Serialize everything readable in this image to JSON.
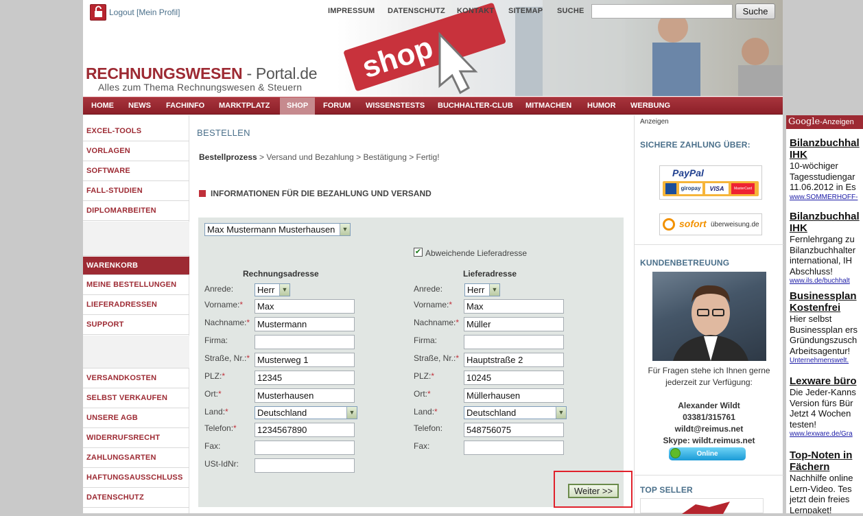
{
  "header": {
    "logout": "Logout",
    "profile": "[Mein Profil]",
    "topnav": [
      "IMPRESSUM",
      "DATENSCHUTZ",
      "KONTAKT",
      "SITEMAP",
      "SUCHE"
    ],
    "search_button": "Suche",
    "logo_main": "RECHNUNGSWESEN",
    "logo_suffix": " - Portal.de",
    "logo_tagline": "Alles zum Thema Rechnungswesen & Steuern",
    "banner_word": "shop"
  },
  "mainnav": [
    "HOME",
    "NEWS",
    "FACHINFO",
    "MARKTPLATZ",
    "SHOP",
    "FORUM",
    "WISSENSTESTS",
    "BUCHHALTER-CLUB",
    "MITMACHEN",
    "HUMOR",
    "WERBUNG"
  ],
  "mainnav_active": "SHOP",
  "sidebar": {
    "group1": [
      "EXCEL-TOOLS",
      "VORLAGEN",
      "SOFTWARE",
      "FALL-STUDIEN",
      "DIPLOMARBEITEN"
    ],
    "cart_header": "WARENKORB",
    "group2": [
      "MEINE BESTELLUNGEN",
      "LIEFERADRESSEN",
      "SUPPORT"
    ],
    "group3": [
      "VERSANDKOSTEN",
      "SELBST VERKAUFEN",
      "UNSERE AGB",
      "WIDERRUFSRECHT",
      "ZAHLUNGSARTEN",
      "HAFTUNGSAUSSCHLUSS",
      "DATENSCHUTZ"
    ]
  },
  "content": {
    "title": "BESTELLEN",
    "crumbs": {
      "current": "Bestellprozess",
      "rest": " > Versand und Bezahlung > Bestätigung > Fertig!"
    },
    "section": "INFORMATIONEN FÜR DIE BEZAHLUNG UND VERSAND",
    "address_select": "Max Mustermann Musterhausen",
    "alt_delivery_label": "Abweichende Lieferadresse",
    "alt_delivery_checked": true,
    "billing": {
      "heading": "Rechnungsadresse",
      "labels": {
        "anrede": "Anrede:",
        "vorname": "Vorname:",
        "nachname": "Nachname:",
        "firma": "Firma:",
        "strasse": "Straße, Nr.:",
        "plz": "PLZ:",
        "ort": "Ort:",
        "land": "Land:",
        "telefon": "Telefon:",
        "fax": "Fax:",
        "ustid": "USt-IdNr:"
      },
      "values": {
        "anrede": "Herr",
        "vorname": "Max",
        "nachname": "Mustermann",
        "firma": "",
        "strasse": "Musterweg 1",
        "plz": "12345",
        "ort": "Musterhausen",
        "land": "Deutschland",
        "telefon": "1234567890",
        "fax": "",
        "ustid": ""
      }
    },
    "delivery": {
      "heading": "Lieferadresse",
      "labels": {
        "anrede": "Anrede:",
        "vorname": "Vorname:",
        "nachname": "Nachname:",
        "firma": "Firma:",
        "strasse": "Straße, Nr.:",
        "plz": "PLZ:",
        "ort": "Ort:",
        "land": "Land:",
        "telefon": "Telefon:",
        "fax": "Fax:"
      },
      "values": {
        "anrede": "Herr",
        "vorname": "Max",
        "nachname": "Müller",
        "firma": "",
        "strasse": "Hauptstraße 2",
        "plz": "10245",
        "ort": "Müllerhausen",
        "land": "Deutschland",
        "telefon": "548756075",
        "fax": ""
      }
    },
    "required_mark": "*",
    "next_button": "Weiter >>"
  },
  "right": {
    "anzeigen": "Anzeigen",
    "payment_heading": "SICHERE ZAHLUNG ÜBER:",
    "paypal": "PayPal",
    "paypal_cards": [
      "giropay",
      "VISA",
      "MasterCard"
    ],
    "sofort": "sofort",
    "sofort_suffix": "überweisung.de",
    "support_heading": "KUNDENBETREUUNG",
    "support_text1": "Für Fragen stehe ich Ihnen gerne",
    "support_text2": "jederzeit zur Verfügung:",
    "contact_name": "Alexander Wildt",
    "contact_phone": "03381/315761",
    "contact_email": "wildt@reimus.net",
    "contact_skype": "Skype: wildt.reimus.net",
    "online": "Online",
    "topseller": "TOP SELLER"
  },
  "google_ads": {
    "brand": "Google",
    "label": "-Anzeigen",
    "ads": [
      {
        "title": "Bilanzbuchhal\nIHK",
        "desc": "10-wöchiger\nTagesstudiengar\n11.06.2012 in Es",
        "url": "www.SOMMERHOFF-"
      },
      {
        "title": "Bilanzbuchhal\nIHK",
        "desc": "Fernlehrgang zu\nBilanzbuchhalter\ninternational, IH\nAbschluss!",
        "url": "www.ils.de/buchhalt"
      },
      {
        "title": "Businessplan\nKostenfrei",
        "desc": "Hier selbst\nBusinessplan ers\nGründungszusch\nArbeitsagentur!",
        "url": "Unternehmenswelt."
      },
      {
        "title": "Lexware büro",
        "desc": "Die Jeder-Kanns\nVersion fürs Bür\nJetzt 4 Wochen\ntesten!",
        "url": "www.lexware.de/Gra"
      },
      {
        "title": "Top-Noten in\nFächern",
        "desc": "Nachhilfe online\nLern-Video. Tes\njetzt dein freies\nLernpaket!",
        "url": ""
      }
    ]
  },
  "colors": {
    "brand_red": "#9d2a33",
    "link_blue": "#4a6f8a",
    "form_bg": "#e1e6e3",
    "highlight": "#e0202a"
  }
}
